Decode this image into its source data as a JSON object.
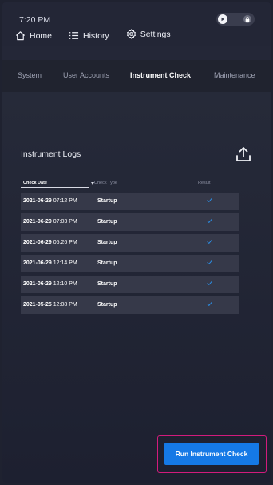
{
  "status_bar": {
    "time": "7:20 PM"
  },
  "nav": {
    "items": [
      {
        "label": "Home",
        "icon": "home-icon",
        "active": false
      },
      {
        "label": "History",
        "icon": "list-icon",
        "active": false
      },
      {
        "label": "Settings",
        "icon": "gear-icon",
        "active": true
      }
    ]
  },
  "subtabs": [
    {
      "label": "System",
      "active": false
    },
    {
      "label": "User Accounts",
      "active": false
    },
    {
      "label": "Instrument Check",
      "active": true
    },
    {
      "label": "Maintenance",
      "active": false
    }
  ],
  "logs": {
    "title": "Instrument Logs",
    "upload_icon": "upload-icon",
    "columns": {
      "date": "Check Date",
      "type": "Check Type",
      "result": "Result"
    },
    "rows": [
      {
        "date": "2021-06-29",
        "time": "07:12 PM",
        "type": "Startup",
        "result": "pass"
      },
      {
        "date": "2021-06-29",
        "time": "07:03 PM",
        "type": "Startup",
        "result": "pass"
      },
      {
        "date": "2021-06-29",
        "time": "05:26 PM",
        "type": "Startup",
        "result": "pass"
      },
      {
        "date": "2021-06-29",
        "time": "12:14 PM",
        "type": "Startup",
        "result": "pass"
      },
      {
        "date": "2021-06-29",
        "time": "12:10 PM",
        "type": "Startup",
        "result": "pass"
      },
      {
        "date": "2021-05-25",
        "time": "12:08 PM",
        "type": "Startup",
        "result": "pass"
      }
    ]
  },
  "actions": {
    "run_label": "Run Instrument Check"
  },
  "colors": {
    "accent": "#1579e6",
    "highlight": "#d21b7c",
    "check": "#2b8fe8",
    "background": "#1f2230",
    "row": "#363949"
  }
}
